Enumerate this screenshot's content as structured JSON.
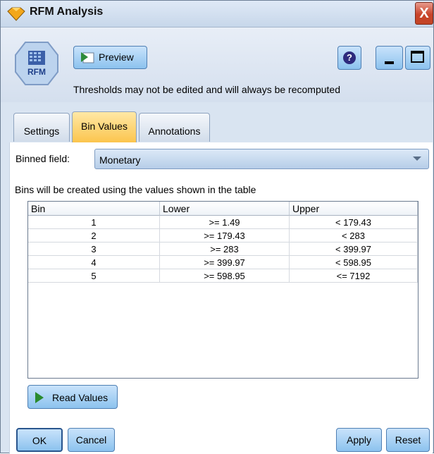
{
  "window": {
    "title": "RFM Analysis",
    "close_glyph": "X"
  },
  "node_icon": {
    "label": "RFM"
  },
  "toolbar": {
    "preview_label": "Preview",
    "help_glyph": "?"
  },
  "notice": "Thresholds may not be edited and will always be recomputed",
  "tabs": [
    {
      "label": "Settings",
      "active": false
    },
    {
      "label": "Bin Values",
      "active": true
    },
    {
      "label": "Annotations",
      "active": false
    }
  ],
  "binned_field": {
    "label": "Binned field:",
    "value": "Monetary"
  },
  "bins_note": "Bins will be created using the values shown in the table",
  "table": {
    "headers": [
      "Bin",
      "Lower",
      "Upper"
    ],
    "rows": [
      [
        "1",
        ">= 1.49",
        "< 179.43"
      ],
      [
        "2",
        ">= 179.43",
        "< 283"
      ],
      [
        "3",
        ">= 283",
        "< 399.97"
      ],
      [
        "4",
        ">= 399.97",
        "< 598.95"
      ],
      [
        "5",
        ">= 598.95",
        "<= 7192"
      ]
    ]
  },
  "read_values_label": "Read Values",
  "buttons": {
    "ok": "OK",
    "cancel": "Cancel",
    "apply": "Apply",
    "reset": "Reset"
  },
  "colors": {
    "active_tab": "#fbc54e",
    "button": "#8cc2ee",
    "close": "#c8432a"
  }
}
